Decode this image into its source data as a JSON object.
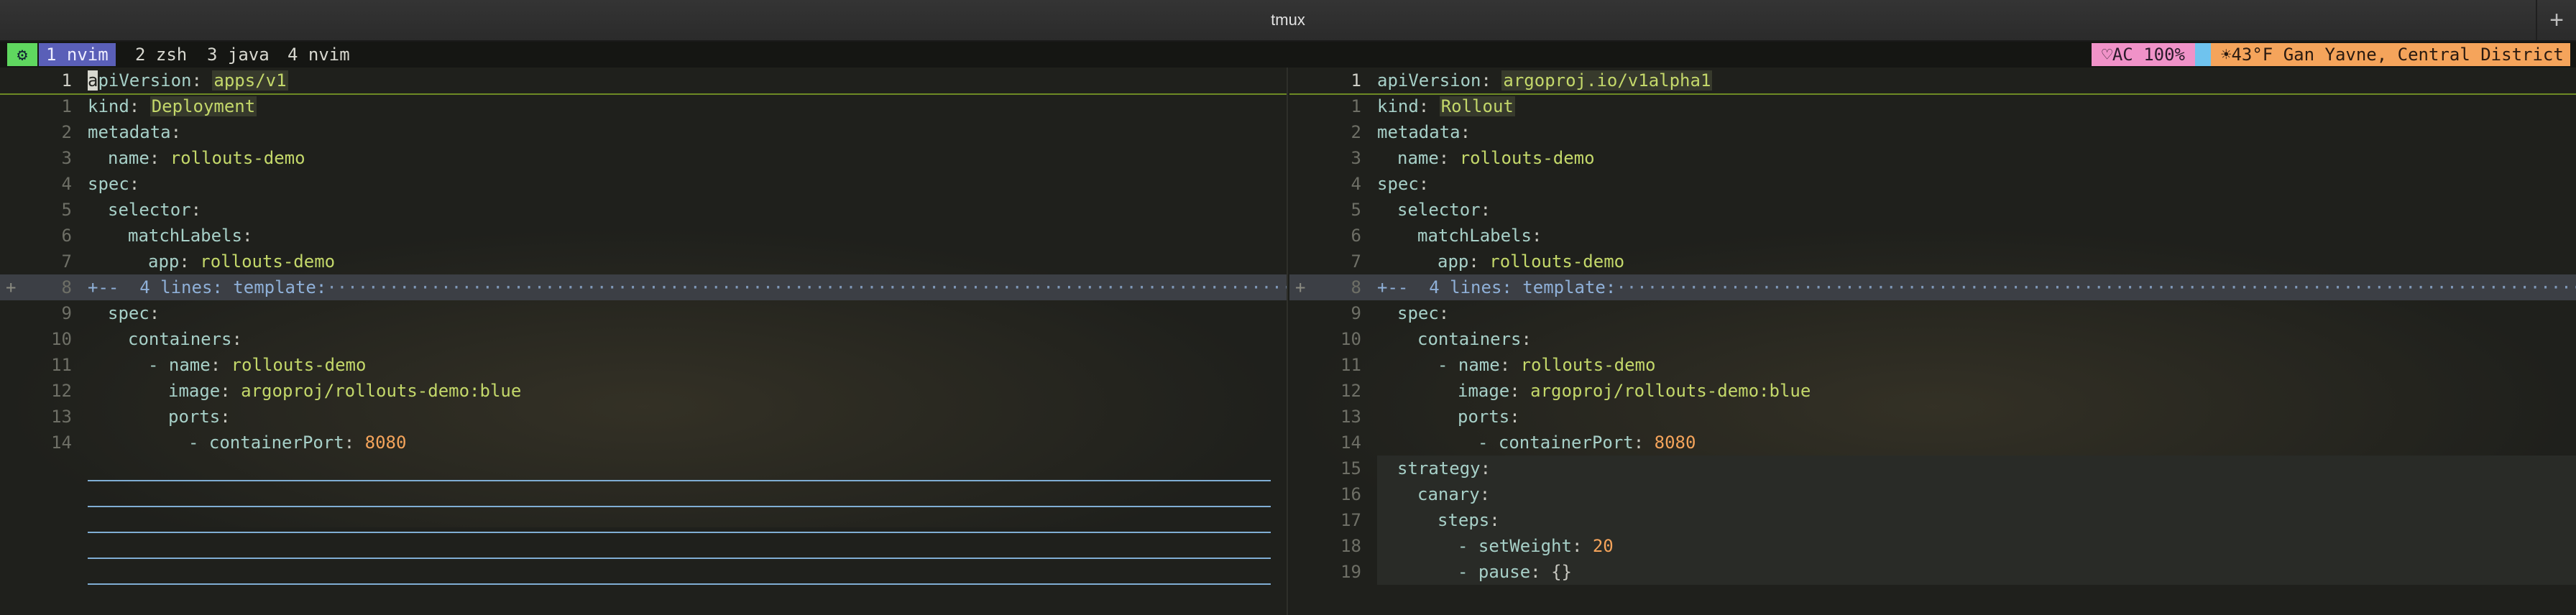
{
  "window": {
    "title": "tmux",
    "new_tab_label": "+"
  },
  "statusbar": {
    "mode_icon": "⚙",
    "windows": [
      {
        "label": "1 nvim",
        "active": true
      },
      {
        "label": "2 zsh",
        "active": false
      },
      {
        "label": "3 java",
        "active": false
      },
      {
        "label": "4 nvim",
        "active": false
      }
    ],
    "ac_icon": "heart-icon",
    "ac": "AC 100%",
    "weather_icon": "sun-icon",
    "weather": "43°F Gan Yavne, Central District"
  },
  "left": {
    "lines": [
      {
        "num": "1",
        "k": "apiVersion",
        "v": "apps/v1",
        "type": "val"
      },
      {
        "num": "1",
        "k": "kind",
        "v": "Deployment",
        "type": "val"
      },
      {
        "num": "2",
        "k": "metadata",
        "v": "",
        "type": "val"
      },
      {
        "num": "3",
        "k": "name",
        "v": "rollouts-demo",
        "type": "val"
      },
      {
        "num": "4",
        "k": "spec",
        "v": "",
        "type": "val"
      },
      {
        "num": "5",
        "k": "selector",
        "v": "",
        "type": "val"
      },
      {
        "num": "6",
        "k": "matchLabels",
        "v": "",
        "type": "val"
      },
      {
        "num": "7",
        "k": "app",
        "v": "rollouts-demo",
        "type": "val"
      },
      {
        "num": "8",
        "fold": "+--  4 lines: template:"
      },
      {
        "num": "9",
        "k": "spec",
        "v": "",
        "type": "val"
      },
      {
        "num": "10",
        "k": "containers",
        "v": "",
        "type": "val"
      },
      {
        "num": "11",
        "k": "- name",
        "v": "rollouts-demo",
        "type": "val"
      },
      {
        "num": "12",
        "k": "image",
        "v": "argoproj/rollouts-demo:blue",
        "type": "val"
      },
      {
        "num": "13",
        "k": "ports",
        "v": "",
        "type": "val"
      },
      {
        "num": "14",
        "k": "- containerPort",
        "v": "8080",
        "type": "num"
      }
    ],
    "fold_sign": "+"
  },
  "right": {
    "lines": [
      {
        "num": "1",
        "k": "apiVersion",
        "v": "argoproj.io/v1alpha1",
        "type": "val"
      },
      {
        "num": "1",
        "k": "kind",
        "v": "Rollout",
        "type": "val"
      },
      {
        "num": "2",
        "k": "metadata",
        "v": "",
        "type": "val"
      },
      {
        "num": "3",
        "k": "name",
        "v": "rollouts-demo",
        "type": "val"
      },
      {
        "num": "4",
        "k": "spec",
        "v": "",
        "type": "val"
      },
      {
        "num": "5",
        "k": "selector",
        "v": "",
        "type": "val"
      },
      {
        "num": "6",
        "k": "matchLabels",
        "v": "",
        "type": "val"
      },
      {
        "num": "7",
        "k": "app",
        "v": "rollouts-demo",
        "type": "val"
      },
      {
        "num": "8",
        "fold": "+--  4 lines: template:"
      },
      {
        "num": "9",
        "k": "spec",
        "v": "",
        "type": "val"
      },
      {
        "num": "10",
        "k": "containers",
        "v": "",
        "type": "val"
      },
      {
        "num": "11",
        "k": "- name",
        "v": "rollouts-demo",
        "type": "val"
      },
      {
        "num": "12",
        "k": "image",
        "v": "argoproj/rollouts-demo:blue",
        "type": "val"
      },
      {
        "num": "13",
        "k": "ports",
        "v": "",
        "type": "val"
      },
      {
        "num": "14",
        "k": "- containerPort",
        "v": "8080",
        "type": "num"
      },
      {
        "num": "15",
        "k": "strategy",
        "v": "",
        "type": "val"
      },
      {
        "num": "16",
        "k": "canary",
        "v": "",
        "type": "val"
      },
      {
        "num": "17",
        "k": "steps",
        "v": "",
        "type": "val"
      },
      {
        "num": "18",
        "k": "- setWeight",
        "v": "20",
        "type": "num"
      },
      {
        "num": "19",
        "k": "- pause",
        "v": "{}",
        "type": "pun"
      }
    ],
    "fold_sign": "+"
  }
}
